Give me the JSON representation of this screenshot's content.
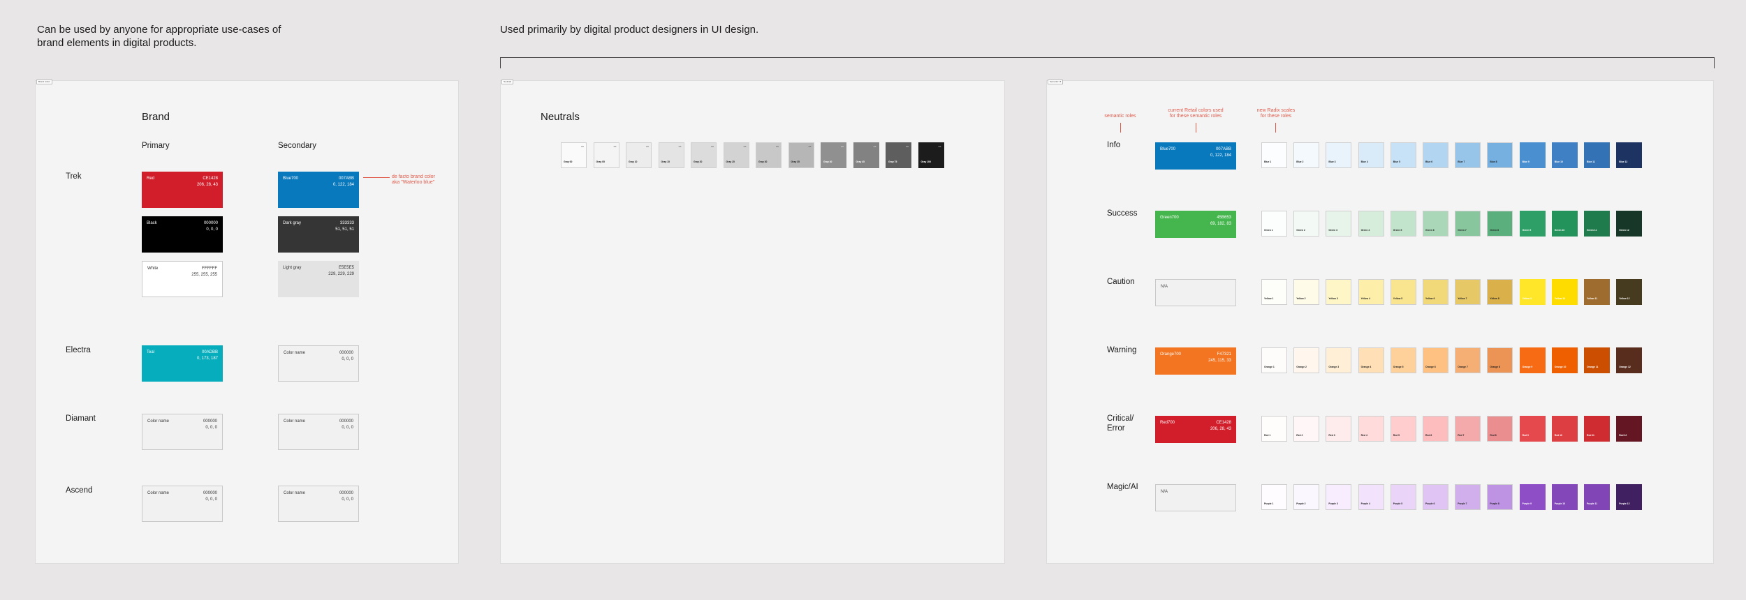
{
  "captions": {
    "brand_line1": "Can be used by anyone for appropriate use-cases of",
    "brand_line2": "brand elements in digital products.",
    "ui": "Used primarily by digital product designers in UI design."
  },
  "frames": {
    "brand": {
      "tag": "Brand colors"
    },
    "neutrals": {
      "tag": "Neutrals"
    },
    "semantic": {
      "tag": "Semantic UI"
    }
  },
  "brand": {
    "title": "Brand",
    "col_primary": "Primary",
    "col_secondary": "Secondary",
    "rows": [
      {
        "label": "Trek"
      },
      {
        "label": "Electra"
      },
      {
        "label": "Diamant"
      },
      {
        "label": "Ascend"
      }
    ],
    "cards": [
      {
        "name": "Red",
        "hex": "CE1428",
        "rgb": "206, 28, 43",
        "bg": "#d21e2b",
        "fg": "#ffffff"
      },
      {
        "name": "Black",
        "hex": "000000",
        "rgb": "0, 0, 0",
        "bg": "#000000",
        "fg": "#ffffff"
      },
      {
        "name": "White",
        "hex": "FFFFFF",
        "rgb": "255, 255, 255",
        "bg": "#ffffff",
        "fg": "#333333"
      },
      {
        "name": "Blue700",
        "hex": "007ABB",
        "rgb": "0, 122, 184",
        "bg": "#0979bd",
        "fg": "#ffffff"
      },
      {
        "name": "Dark gray",
        "hex": "333333",
        "rgb": "51, 51, 51",
        "bg": "#353535",
        "fg": "#ffffff"
      },
      {
        "name": "Light gray",
        "hex": "E5E5E5",
        "rgb": "229, 229, 229",
        "bg": "#e3e3e3",
        "fg": "#333333"
      },
      {
        "name": "Teal",
        "hex": "00ADBB",
        "rgb": "0, 173, 187",
        "bg": "#06adbc",
        "fg": "#ffffff"
      },
      {
        "name": "Color name",
        "hex": "000000",
        "rgb": "0, 0, 0",
        "bg": "#f1f1f1",
        "fg": "#333333"
      },
      {
        "name": "Color name",
        "hex": "000000",
        "rgb": "0, 0, 0",
        "bg": "#f1f1f1",
        "fg": "#333333"
      },
      {
        "name": "Color name",
        "hex": "000000",
        "rgb": "0, 0, 0",
        "bg": "#f1f1f1",
        "fg": "#333333"
      },
      {
        "name": "Color name",
        "hex": "000000",
        "rgb": "0, 0, 0",
        "bg": "#f1f1f1",
        "fg": "#333333"
      },
      {
        "name": "Color name",
        "hex": "000000",
        "rgb": "0, 0, 0",
        "bg": "#f1f1f1",
        "fg": "#333333"
      }
    ],
    "note_line1": "de facto brand color",
    "note_line2": "aka \"Waterloo blue\""
  },
  "neutrals": {
    "title": "Neutrals",
    "swatches": [
      {
        "name": "Gray 00",
        "top": "AA",
        "bg": "#fafafa",
        "fg": "#222222"
      },
      {
        "name": "Gray 05",
        "top": "AA",
        "bg": "#f4f4f4",
        "fg": "#222222"
      },
      {
        "name": "Gray 10",
        "top": "AA",
        "bg": "#ececec",
        "fg": "#222222"
      },
      {
        "name": "Gray 15",
        "top": "AA",
        "bg": "#e4e4e4",
        "fg": "#222222"
      },
      {
        "name": "Gray 20",
        "top": "AA",
        "bg": "#dcdcdc",
        "fg": "#222222"
      },
      {
        "name": "Gray 25",
        "top": "AA",
        "bg": "#d3d3d3",
        "fg": "#222222"
      },
      {
        "name": "Gray 30",
        "top": "AA",
        "bg": "#c8c8c8",
        "fg": "#222222"
      },
      {
        "name": "Gray 35",
        "top": "AA",
        "bg": "#b6b6b6",
        "fg": "#222222"
      },
      {
        "name": "Gray 40",
        "top": "AA",
        "bg": "#909090",
        "fg": "#ffffff"
      },
      {
        "name": "Gray 45",
        "top": "AA",
        "bg": "#828282",
        "fg": "#ffffff"
      },
      {
        "name": "Gray 75",
        "top": "AA",
        "bg": "#5e5e5e",
        "fg": "#ffffff"
      },
      {
        "name": "Gray 100",
        "top": "AA",
        "bg": "#1c1c1c",
        "fg": "#ffffff"
      }
    ]
  },
  "semantic": {
    "notes": [
      {
        "line1": "semantic roles",
        "line2": ""
      },
      {
        "line1": "current Retail colors used",
        "line2": "for these semantic roles"
      },
      {
        "line1": "new Radix scales",
        "line2": "for these roles"
      }
    ],
    "rows": [
      {
        "label": "Info",
        "label2": "",
        "card": {
          "na": false,
          "name": "Blue700",
          "hex": "007ABB",
          "rgb": "0, 122, 184",
          "bg": "#0979bd"
        },
        "scale": "Blue",
        "colors": [
          "#fbfdff",
          "#f4f9fd",
          "#e8f3fb",
          "#d9ebf9",
          "#c7e1f6",
          "#b2d5f1",
          "#97c5ea",
          "#75b0e0",
          "#4a8fcf",
          "#3e80c3",
          "#3472b6",
          "#1d3462"
        ]
      },
      {
        "label": "Success",
        "label2": "",
        "card": {
          "na": false,
          "name": "Green700",
          "hex": "45B653",
          "rgb": "69, 182, 83",
          "bg": "#45b64d"
        },
        "scale": "Green",
        "colors": [
          "#fbfefc",
          "#f3faf5",
          "#e6f4ea",
          "#d6eddc",
          "#c3e4cc",
          "#a9d7b8",
          "#88c69d",
          "#5aaf7d",
          "#2e9f66",
          "#24925b",
          "#1f7b4c",
          "#173828"
        ]
      },
      {
        "label": "Caution",
        "label2": "",
        "card": {
          "na": true,
          "name": "N/A",
          "hex": "",
          "rgb": "",
          "bg": "#f1f1f1"
        },
        "scale": "Yellow",
        "colors": [
          "#fdfdf9",
          "#fefbe8",
          "#fff6c8",
          "#fdefa9",
          "#f9e58f",
          "#f1d878",
          "#e6c866",
          "#d9b04a",
          "#ffe629",
          "#ffdc00",
          "#9e6c2e",
          "#473b1f"
        ]
      },
      {
        "label": "Warning",
        "label2": "",
        "card": {
          "na": false,
          "name": "Orange700",
          "hex": "F47321",
          "rgb": "245, 115, 33",
          "bg": "#f47521"
        },
        "scale": "Orange",
        "colors": [
          "#fefcfb",
          "#fff7ed",
          "#ffefd6",
          "#ffdfb5",
          "#ffd19a",
          "#ffc182",
          "#f5ae73",
          "#ec9455",
          "#f76b15",
          "#ef5f00",
          "#cc4e00",
          "#582d1d"
        ]
      },
      {
        "label": "Critical/",
        "label2": "Error",
        "card": {
          "na": false,
          "name": "Red700",
          "hex": "CE1428",
          "rgb": "206, 28, 43",
          "bg": "#d21e2b"
        },
        "scale": "Red",
        "colors": [
          "#fffcfc",
          "#fff7f7",
          "#feebec",
          "#ffdbdc",
          "#ffcdce",
          "#fdbdbe",
          "#f4a9aa",
          "#eb8e90",
          "#e5484d",
          "#dc3e42",
          "#ce2c31",
          "#641723"
        ]
      },
      {
        "label": "Magic/AI",
        "label2": "",
        "card": {
          "na": true,
          "name": "N/A",
          "hex": "",
          "rgb": "",
          "bg": "#f1f1f1"
        },
        "scale": "Purple",
        "colors": [
          "#fefcfe",
          "#fbf7fe",
          "#f7edfe",
          "#f2e2fc",
          "#ead5f9",
          "#e0c4f4",
          "#d1afec",
          "#be93e4",
          "#8e4ec6",
          "#8347b9",
          "#8145b5",
          "#402060"
        ]
      }
    ]
  }
}
